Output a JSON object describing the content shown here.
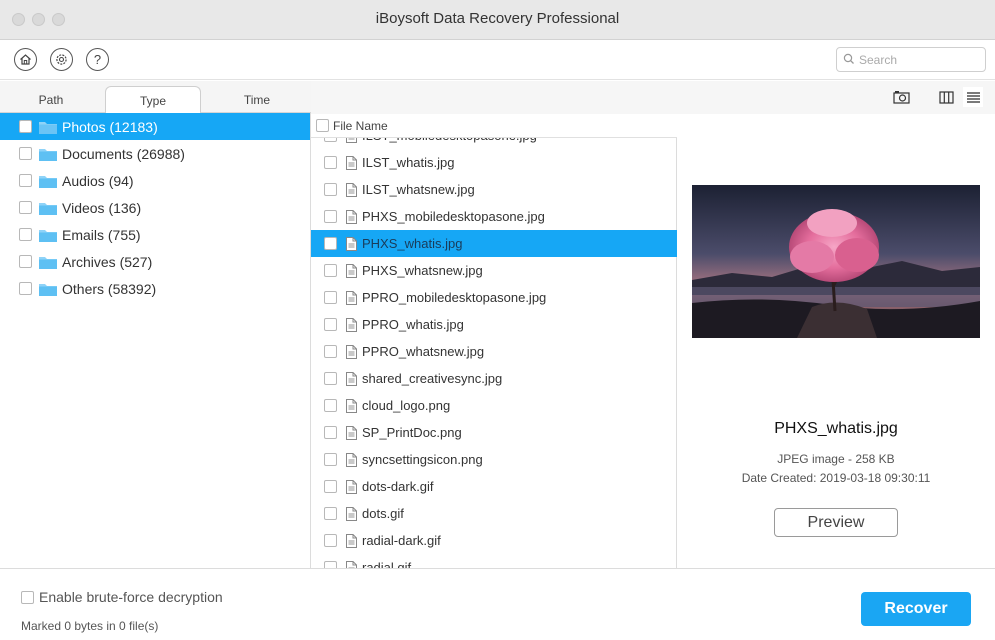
{
  "window": {
    "title": "iBoysoft Data Recovery Professional"
  },
  "toolbar": {
    "help_glyph": "?",
    "search_placeholder": "Search"
  },
  "tabs": [
    {
      "label": "Path"
    },
    {
      "label": "Type"
    },
    {
      "label": "Time"
    }
  ],
  "categories": [
    {
      "label": "Photos (12183)",
      "selected": true
    },
    {
      "label": "Documents (26988)"
    },
    {
      "label": "Audios (94)"
    },
    {
      "label": "Videos (136)"
    },
    {
      "label": "Emails (755)"
    },
    {
      "label": "Archives (527)"
    },
    {
      "label": "Others (58392)"
    }
  ],
  "file_list": {
    "header": "File Name",
    "files": [
      "ILST_mobiledesktopasone.jpg",
      "ILST_whatis.jpg",
      "ILST_whatsnew.jpg",
      "PHXS_mobiledesktopasone.jpg",
      "PHXS_whatis.jpg",
      "PHXS_whatsnew.jpg",
      "PPRO_mobiledesktopasone.jpg",
      "PPRO_whatis.jpg",
      "PPRO_whatsnew.jpg",
      "shared_creativesync.jpg",
      "cloud_logo.png",
      "SP_PrintDoc.png",
      "syncsettingsicon.png",
      "dots-dark.gif",
      "dots.gif",
      "radial-dark.gif",
      "radial.gif"
    ],
    "selected_index": 4
  },
  "preview": {
    "file_name": "PHXS_whatis.jpg",
    "file_info": "JPEG image - 258 KB",
    "date_created": "Date Created: 2019-03-18 09:30:11",
    "preview_label": "Preview"
  },
  "footer": {
    "brute_force_label": "Enable brute-force decryption",
    "marked_status": "Marked 0 bytes in 0 file(s)",
    "recover_label": "Recover"
  },
  "colors": {
    "selection": "#16a7f5",
    "recover_button": "#1aa6f3",
    "folder": "#5ec0f3"
  },
  "icons": {
    "home": "home-icon",
    "settings": "gear-icon",
    "help": "help-icon",
    "search": "search-icon",
    "camera": "camera-icon",
    "columns_view": "columns-view-icon",
    "list_view": "list-view-icon",
    "folder": "folder-icon",
    "file": "file-icon"
  }
}
